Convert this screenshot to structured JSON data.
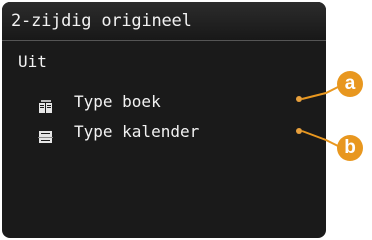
{
  "header": {
    "title": "2-zijdig origineel"
  },
  "options": [
    {
      "label": "Uit",
      "icon": ""
    },
    {
      "label": "Type boek",
      "icon": "book-type-icon"
    },
    {
      "label": "Type kalender",
      "icon": "calendar-type-icon"
    }
  ],
  "callouts": {
    "a": "a",
    "b": "b"
  },
  "colors": {
    "screen_bg": "#1a1a1a",
    "text": "#f2f2f2",
    "callout": "#e8971f"
  }
}
